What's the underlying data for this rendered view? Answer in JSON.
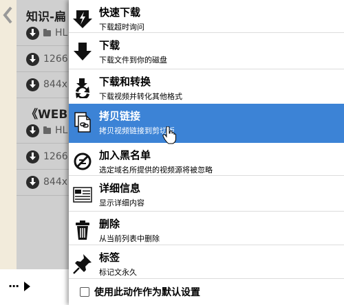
{
  "list": {
    "title1": "知识-扁",
    "title2": "《WEB",
    "items": [
      {
        "text": "HL"
      },
      {
        "text": "1266"
      },
      {
        "text": "844x"
      },
      {
        "text": "HL"
      },
      {
        "text": "1266"
      },
      {
        "text": "844x"
      }
    ]
  },
  "bottom": {
    "more_label": "···"
  },
  "menu": {
    "items": [
      {
        "title": "快速下载",
        "desc": "下载超时询问",
        "icon": "download-bolt-icon"
      },
      {
        "title": "下载",
        "desc": "下载文件到你的磁盘",
        "icon": "download-arrow-icon"
      },
      {
        "title": "下载和转换",
        "desc": "下载视频并转化其他格式",
        "icon": "download-convert-icon"
      },
      {
        "title": "拷贝链接",
        "desc": "拷贝视频链接到剪切板",
        "icon": "copy-link-icon"
      },
      {
        "title": "加入黑名单",
        "desc": "选定域名所提供的视频源将被忽略",
        "icon": "blacklist-icon"
      },
      {
        "title": "详细信息",
        "desc": "显示详细内容",
        "icon": "details-icon"
      },
      {
        "title": "删除",
        "desc": "从当前列表中删除",
        "icon": "trash-icon"
      },
      {
        "title": "标签",
        "desc": "标记文永久",
        "icon": "pin-icon"
      }
    ],
    "active_index": 3,
    "default_label": "使用此动作作为默认设置",
    "default_checked": false
  },
  "colors": {
    "accent": "#3c83d6",
    "list_bg": "#cfcfcf",
    "strip_bg": "#f2ebdb"
  }
}
